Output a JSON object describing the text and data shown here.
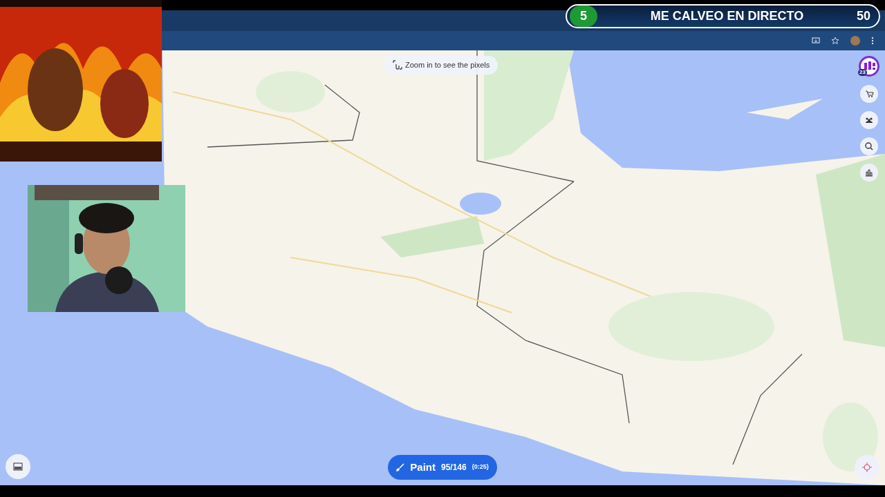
{
  "stream_overlay": {
    "counter": "5",
    "title": "ME CALVEO EN DIRECTO",
    "score": "50"
  },
  "map": {
    "kind": "picture",
    "zoom_hint": "Zoom in to see the pixels",
    "user_badge": "23",
    "paint_button": {
      "label": "Paint",
      "count": "95/146",
      "timer": "(0:25)"
    }
  }
}
